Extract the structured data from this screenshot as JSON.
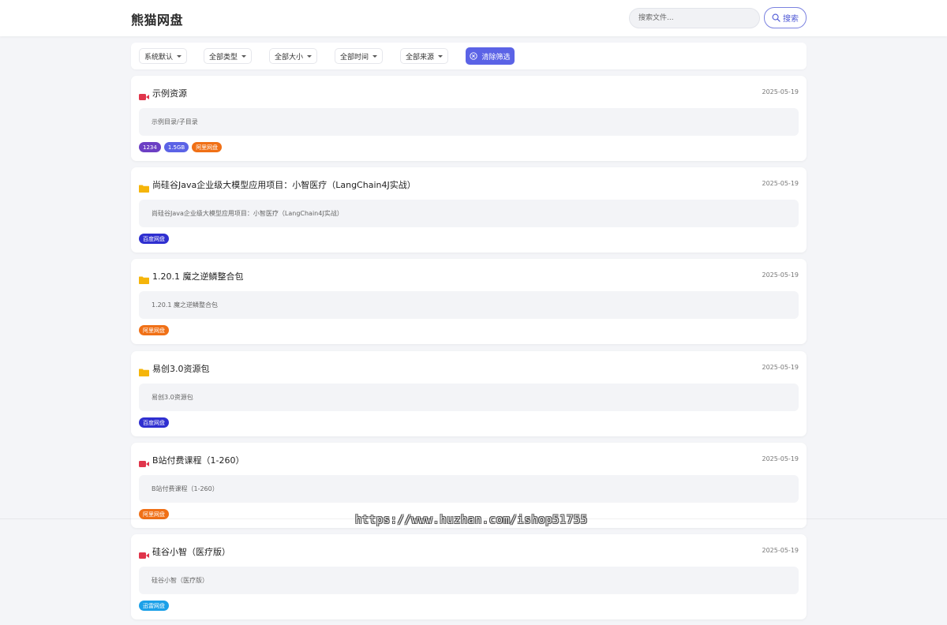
{
  "header": {
    "brand": "熊猫网盘",
    "search_placeholder": "搜索文件...",
    "search_button": "搜索"
  },
  "filters": {
    "items": [
      {
        "label": "系统默认"
      },
      {
        "label": "全部类型"
      },
      {
        "label": "全部大小"
      },
      {
        "label": "全部时间"
      },
      {
        "label": "全部来源"
      }
    ],
    "clear_label": "清除筛选"
  },
  "colors": {
    "accent": "#5b63e6",
    "video_icon": "#e0354b",
    "folder_icon": "#f5b50a",
    "tag_count": "#6c3fc4",
    "tag_size": "#5b63e6",
    "tag_aliyun": "#f07016",
    "tag_baidu": "#2f2fd0",
    "tag_xunlei": "#1ba0e8"
  },
  "cards": [
    {
      "icon": "video-icon",
      "title": "示例资源",
      "date": "2025-05-19",
      "path": "示例目录/子目录",
      "tags": [
        {
          "label": "1234",
          "color": "#6c3fc4"
        },
        {
          "label": "1.5GB",
          "color": "#5b63e6"
        },
        {
          "label": "阿里网盘",
          "color": "#f07016"
        }
      ]
    },
    {
      "icon": "folder-icon",
      "title": "尚硅谷Java企业级大模型应用项目：小智医疗（LangChain4J实战）",
      "date": "2025-05-19",
      "path": "尚硅谷Java企业级大模型应用项目：小智医疗（LangChain4J实战）",
      "tags": [
        {
          "label": "百度网盘",
          "color": "#2f2fd0"
        }
      ]
    },
    {
      "icon": "folder-icon",
      "title": "1.20.1 魔之逆鳞整合包",
      "date": "2025-05-19",
      "path": "1.20.1 魔之逆鳞整合包",
      "tags": [
        {
          "label": "阿里网盘",
          "color": "#f07016"
        }
      ]
    },
    {
      "icon": "folder-icon",
      "title": "易创3.0资源包",
      "date": "2025-05-19",
      "path": "易创3.0资源包",
      "tags": [
        {
          "label": "百度网盘",
          "color": "#2f2fd0"
        }
      ]
    },
    {
      "icon": "video-icon",
      "title": "B站付费课程（1-260）",
      "date": "2025-05-19",
      "path": "B站付费课程（1-260）",
      "tags": [
        {
          "label": "阿里网盘",
          "color": "#f07016"
        }
      ]
    },
    {
      "icon": "video-icon",
      "title": "硅谷小智（医疗版）",
      "date": "2025-05-19",
      "path": "硅谷小智（医疗版）",
      "tags": [
        {
          "label": "迅雷网盘",
          "color": "#1ba0e8"
        }
      ]
    }
  ],
  "watermark": "https://www.huzhan.com/ishop51755"
}
